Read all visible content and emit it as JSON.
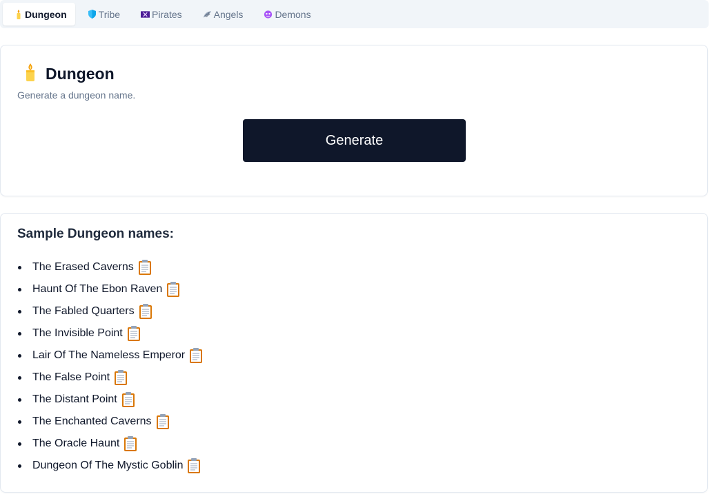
{
  "tabs": [
    {
      "label": "Dungeon",
      "icon": "candle-icon",
      "active": true
    },
    {
      "label": "Tribe",
      "icon": "shield-icon",
      "active": false
    },
    {
      "label": "Pirates",
      "icon": "pirate-flag-icon",
      "active": false
    },
    {
      "label": "Angels",
      "icon": "wing-icon",
      "active": false
    },
    {
      "label": "Demons",
      "icon": "goblin-icon",
      "active": false
    }
  ],
  "generator": {
    "title": "Dungeon",
    "icon": "candle-icon",
    "description": "Generate a dungeon name.",
    "button_label": "Generate"
  },
  "samples": {
    "heading": "Sample Dungeon names:",
    "items": [
      "The Erased Caverns",
      "Haunt Of The Ebon Raven",
      "The Fabled Quarters",
      "The Invisible Point",
      "Lair Of The Nameless Emperor",
      "The False Point",
      "The Distant Point",
      "The Enchanted Caverns",
      "The Oracle Haunt",
      "Dungeon Of The Mystic Goblin"
    ],
    "copy_icon": "clipboard-icon"
  },
  "colors": {
    "accent": "#0f172a",
    "muted_text": "#64748b",
    "tab_bar_bg": "#f1f5f9"
  }
}
